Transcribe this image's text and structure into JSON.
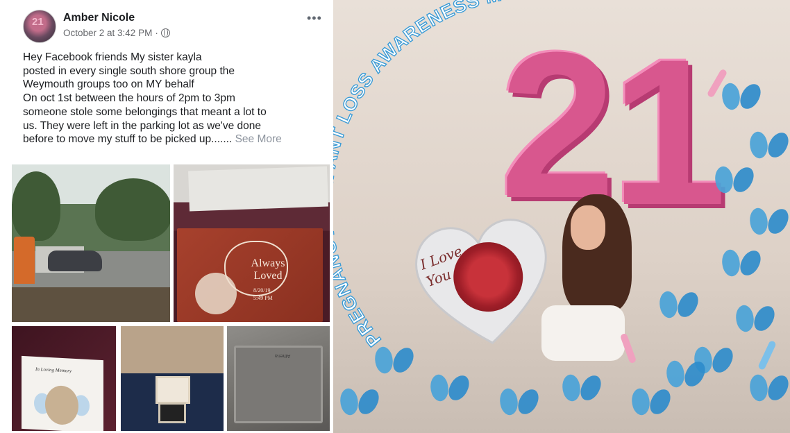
{
  "post": {
    "author": "Amber Nicole",
    "timestamp": "October 2 at 3:42 PM",
    "separator": "·",
    "privacy_icon": "globe-icon",
    "more_icon": "•••",
    "avatar_text": "21",
    "lines": [
      "Hey Facebook friends My  sister  kayla",
      "posted in every single south shore group the",
      "Weymouth groups too on MY behalf",
      "On oct 1st between the hours of 2pm to 3pm",
      "someone stole some belongings that meant a lot to",
      "us. They were left in the parking lot as we've done",
      "before to move my stuff to be picked up......."
    ],
    "see_more": "See More",
    "photos": {
      "book_always": "Always",
      "book_loved": "Loved",
      "book_date": "8/20/19",
      "book_time": "5:49 PM",
      "card_caption": "In Loving Memory",
      "tray_label": "Athena"
    }
  },
  "awareness": {
    "arc_title": "PREGNANCY & INFANT LOSS AWARENESS MONTH",
    "balloon_number_1": "2",
    "balloon_number_2": "1",
    "heart_love": "I Love",
    "heart_you": "You",
    "colors": {
      "text": "#ffffff",
      "text_outline": "#3a9bd6",
      "balloon": "#d8578e",
      "butterfly": "#4aa3d8",
      "ribbon": "#f0a1bf"
    }
  }
}
